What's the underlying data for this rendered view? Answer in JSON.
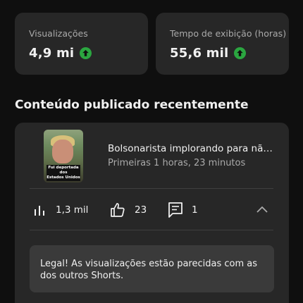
{
  "stats": [
    {
      "label": "Visualizações",
      "value": "4,9 mi",
      "trend_icon": "arrow-up-circle-icon"
    },
    {
      "label": "Tempo de exibição (horas)",
      "value": "55,6 mil",
      "trend_icon": "arrow-up-circle-icon"
    }
  ],
  "section": {
    "title": "Conteúdo publicado recentemente"
  },
  "video": {
    "thumbnail_caption_line1": "Fui deportada dos",
    "thumbnail_caption_line2": "Estados Unidos",
    "title": "Bolsonarista implorando para não s...",
    "subtitle": "Primeiras 1 horas, 23 minutos",
    "metrics": {
      "views": "1,3 mil",
      "likes": "23",
      "comments": "1"
    }
  },
  "insight": {
    "text": "Legal! As visualizações estão parecidas com as dos outros Shorts."
  },
  "colors": {
    "background": "#0f0f0f",
    "card": "#272727",
    "trend_up": "#2ba640",
    "secondary_text": "#aaaaaa"
  }
}
